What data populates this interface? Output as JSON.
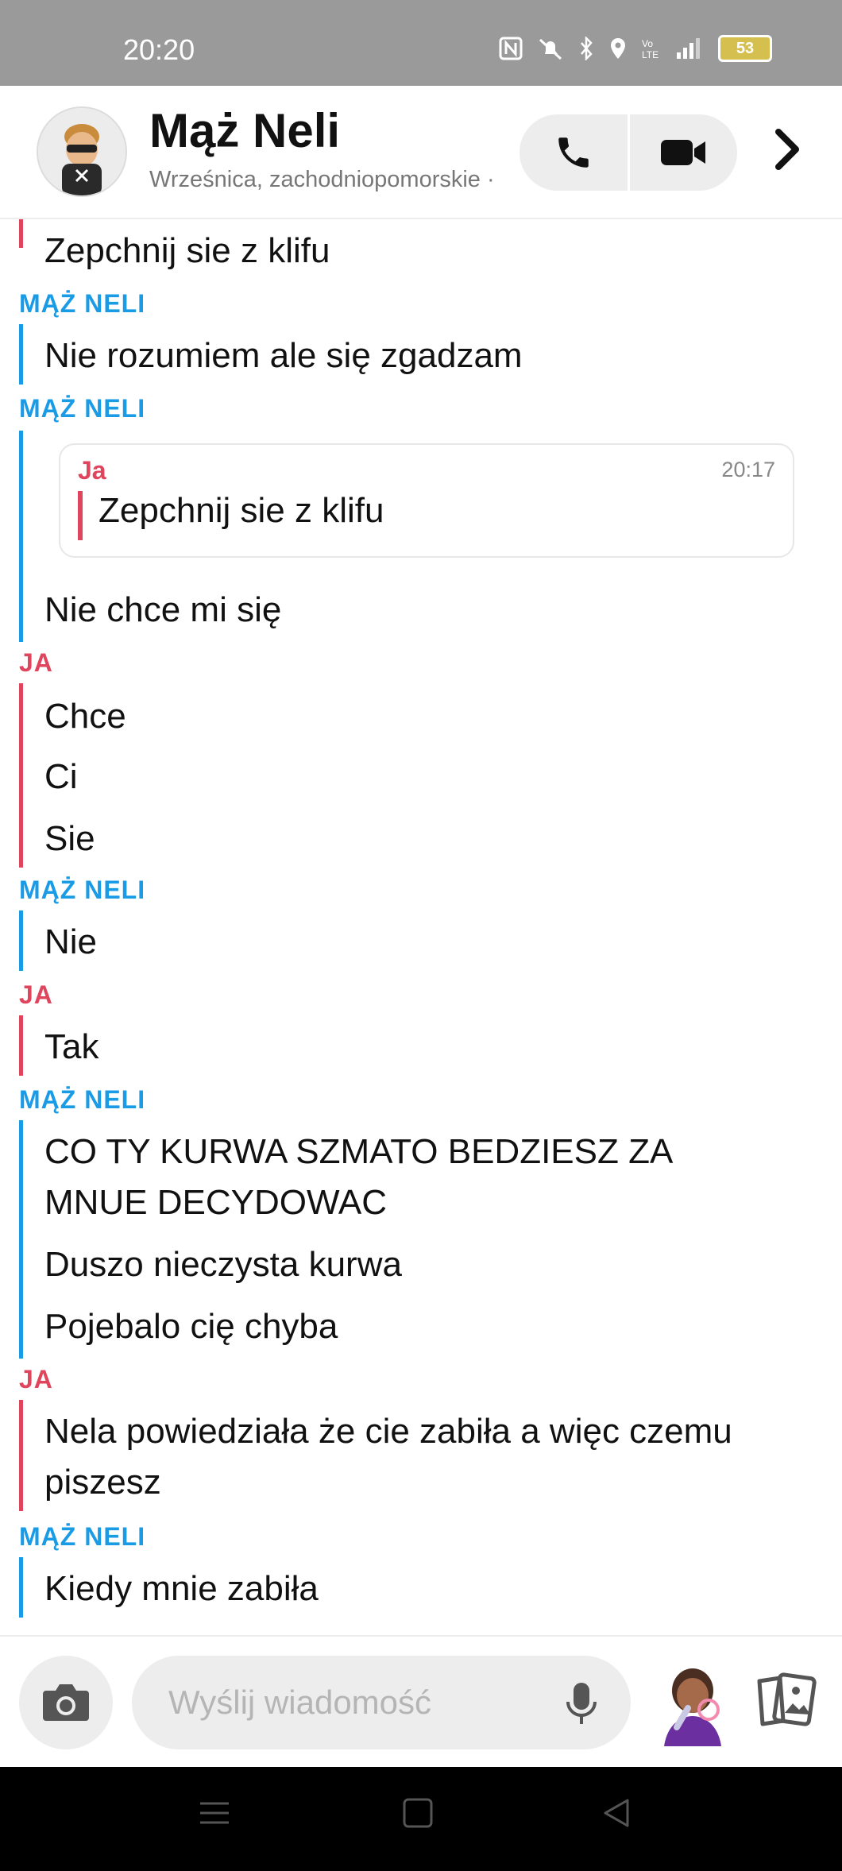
{
  "status_bar": {
    "time": "20:20",
    "battery": "53"
  },
  "header": {
    "name": "Mąż Neli",
    "location": "Wrześnica, zachodniopomorskie",
    "location_suffix": "·"
  },
  "chat": {
    "first_message": "Zepchnij sie z klifu",
    "sender_them": "MĄŻ NELI",
    "sender_me": "JA",
    "msg_1": "Nie rozumiem ale się zgadzam",
    "quote": {
      "sender": "Ja",
      "time": "20:17",
      "text": "Zepchnij sie z klifu"
    },
    "msg_2": "Nie chce mi się",
    "msg_3": "Chce",
    "msg_4": "Ci",
    "msg_5": "Sie",
    "msg_6": "Nie",
    "msg_7": "Tak",
    "msg_8": "CO TY KURWA SZMATO BEDZIESZ ZA MNUE DECYDOWAC",
    "msg_9": "Duszo nieczysta kurwa",
    "msg_10": "Pojebalo cię chyba",
    "msg_11": "Nela powiedziała że cie zabiła a więc czemu piszesz",
    "msg_12": "Kiedy mnie zabiła"
  },
  "composer": {
    "placeholder": "Wyślij wiadomość",
    "value": ""
  },
  "icons": {
    "call": "phone-icon",
    "video": "video-camera-icon",
    "more": "chevron-right-icon",
    "camera": "camera-icon",
    "mic": "microphone-icon",
    "cards": "cards-icon"
  },
  "colors": {
    "them": "#1a9be6",
    "me": "#e0455e",
    "status_bar": "#9a9a9a",
    "pill": "#ededed"
  }
}
